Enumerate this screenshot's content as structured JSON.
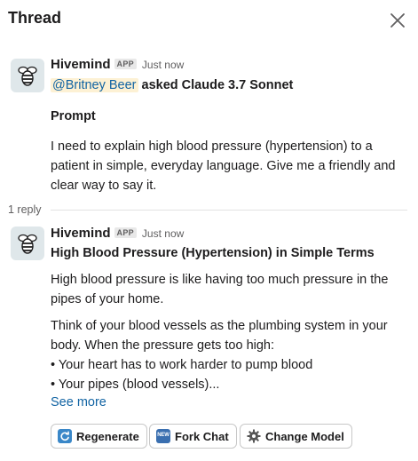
{
  "header": {
    "title": "Thread"
  },
  "parent_message": {
    "author": "Hivemind",
    "badge": "APP",
    "time": "Just now",
    "mention": "@Britney Beer",
    "action_text": " asked Claude 3.7 Sonnet",
    "prompt_heading": "Prompt",
    "prompt_lines": [
      "I need to explain high blood pressure (hypertension) to a",
      "patient in simple, everyday language. Give me a friendly and",
      "clear way to say it."
    ]
  },
  "reply_divider": {
    "label": "1 reply"
  },
  "reply_message": {
    "author": "Hivemind",
    "badge": "APP",
    "time": "Just now",
    "heading": "High Blood Pressure (Hypertension) in Simple Terms",
    "paragraph1_lines": [
      "High blood pressure is like having too much pressure in the",
      "pipes of your home."
    ],
    "paragraph2_lines": [
      "Think of your blood vessels as the plumbing system in your",
      "body. When the pressure gets too high:"
    ],
    "bullets": [
      "• Your heart has to work harder to pump blood",
      "• Your pipes (blood vessels)..."
    ],
    "see_more": "See more"
  },
  "actions": {
    "regenerate": "Regenerate",
    "fork_chat": "Fork Chat",
    "change_model": "Change Model",
    "new_badge": "NEW"
  },
  "icons": {
    "close": "close-icon",
    "avatar": "bee-icon",
    "regenerate": "refresh-icon",
    "fork": "new-badge-icon",
    "model": "gear-icon"
  },
  "colors": {
    "link": "#1264a3",
    "mention_bg": "#fdf1d4",
    "avatar_bg": "#dfe7ea",
    "muted": "#616061"
  }
}
